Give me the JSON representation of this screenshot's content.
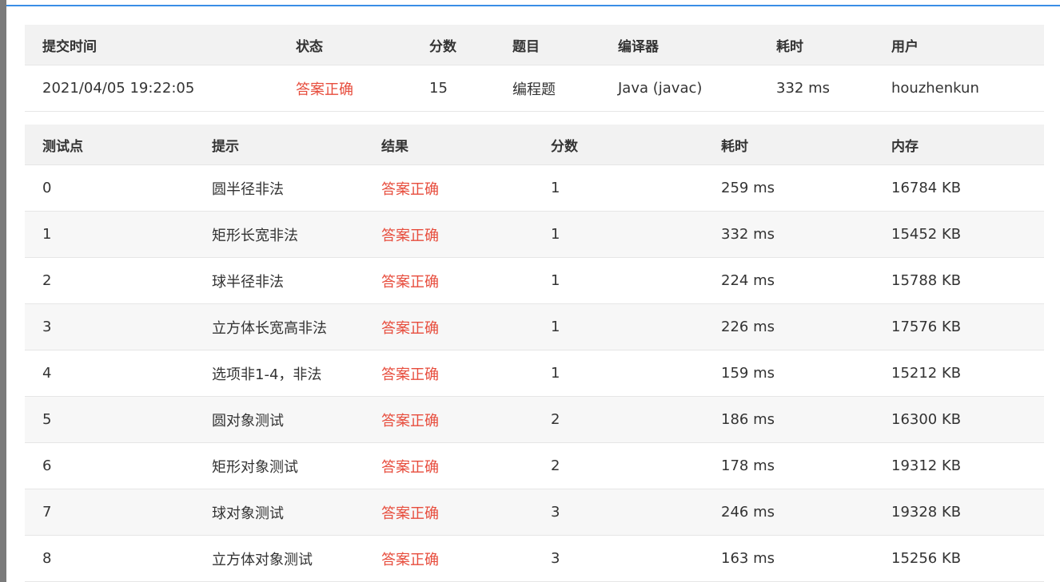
{
  "summary": {
    "headers": [
      "提交时间",
      "状态",
      "分数",
      "题目",
      "编译器",
      "耗时",
      "用户"
    ],
    "row": {
      "time": "2021/04/05 19:22:05",
      "status": "答案正确",
      "score": "15",
      "problem": "编程题",
      "compiler": "Java (javac)",
      "elapsed": "332 ms",
      "user": "houzhenkun"
    }
  },
  "cases": {
    "headers": [
      "测试点",
      "提示",
      "结果",
      "分数",
      "耗时",
      "内存"
    ],
    "rows": [
      {
        "id": "0",
        "hint": "圆半径非法",
        "result": "答案正确",
        "score": "1",
        "time": "259 ms",
        "memory": "16784 KB"
      },
      {
        "id": "1",
        "hint": "矩形长宽非法",
        "result": "答案正确",
        "score": "1",
        "time": "332 ms",
        "memory": "15452 KB"
      },
      {
        "id": "2",
        "hint": "球半径非法",
        "result": "答案正确",
        "score": "1",
        "time": "224 ms",
        "memory": "15788 KB"
      },
      {
        "id": "3",
        "hint": "立方体长宽高非法",
        "result": "答案正确",
        "score": "1",
        "time": "226 ms",
        "memory": "17576 KB"
      },
      {
        "id": "4",
        "hint": "选项非1-4，非法",
        "result": "答案正确",
        "score": "1",
        "time": "159 ms",
        "memory": "15212 KB"
      },
      {
        "id": "5",
        "hint": "圆对象测试",
        "result": "答案正确",
        "score": "2",
        "time": "186 ms",
        "memory": "16300 KB"
      },
      {
        "id": "6",
        "hint": "矩形对象测试",
        "result": "答案正确",
        "score": "2",
        "time": "178 ms",
        "memory": "19312 KB"
      },
      {
        "id": "7",
        "hint": "球对象测试",
        "result": "答案正确",
        "score": "3",
        "time": "246 ms",
        "memory": "19328 KB"
      },
      {
        "id": "8",
        "hint": "立方体对象测试",
        "result": "答案正确",
        "score": "3",
        "time": "163 ms",
        "memory": "15256 KB"
      }
    ]
  },
  "colors": {
    "accent_line": "#3a8ee6",
    "status_ok": "#e74c3c",
    "header_bg": "#f2f2f2"
  }
}
